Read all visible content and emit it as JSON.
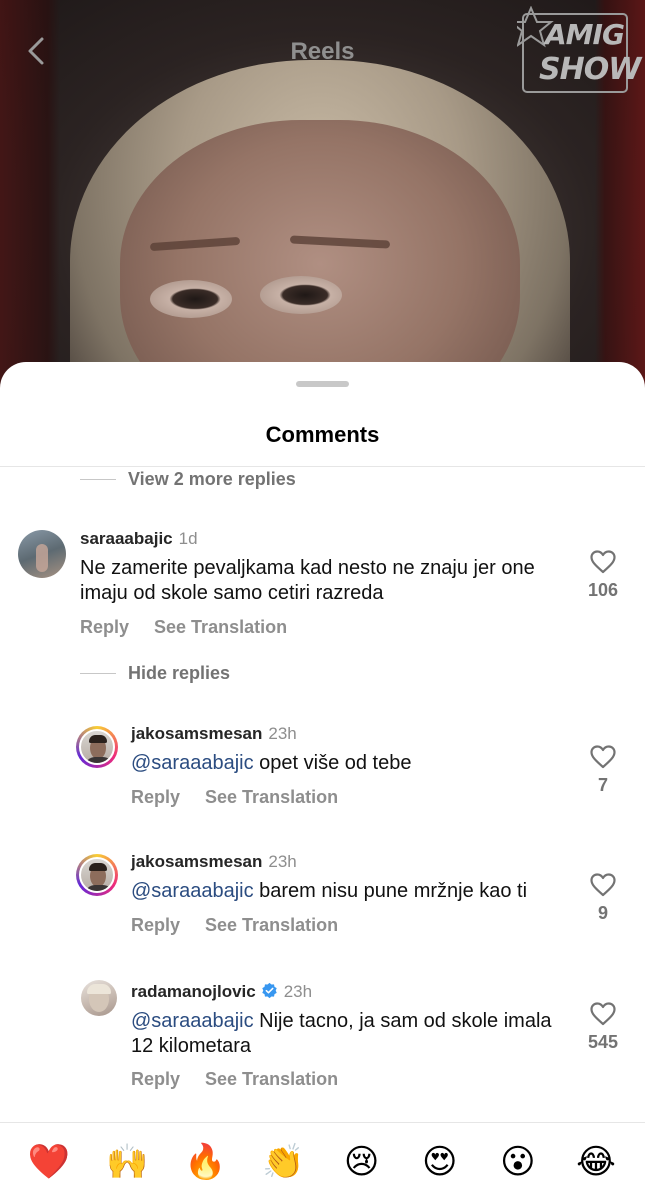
{
  "reel": {
    "title": "Reels",
    "logo_line1": "AMIG",
    "logo_line2": "SHOW"
  },
  "sheet": {
    "title": "Comments",
    "view_more_replies": "View 2 more replies",
    "hide_replies": "Hide replies"
  },
  "comments": [
    {
      "username": "saraaabajic",
      "time": "1d",
      "text": "Ne zamerite pevaljkama kad nesto ne znaju jer one imaju od skole samo cetiri razreda",
      "likes": "106",
      "reply": "Reply",
      "translate": "See Translation"
    },
    {
      "username": "jakosamsmesan",
      "time": "23h",
      "mention": "@saraaabajic",
      "text": " opet više od tebe",
      "likes": "7",
      "reply": "Reply",
      "translate": "See Translation"
    },
    {
      "username": "jakosamsmesan",
      "time": "23h",
      "mention": "@saraaabajic",
      "text": " barem nisu pune mržnje kao ti",
      "likes": "9",
      "reply": "Reply",
      "translate": "See Translation"
    },
    {
      "username": "radamanojlovic",
      "time": "23h",
      "verified": true,
      "mention": "@saraaabajic",
      "text": " Nije tacno, ja sam od skole imala 12 kilometara",
      "likes": "545",
      "reply": "Reply",
      "translate": "See Translation"
    }
  ],
  "emoji_bar": [
    "❤️",
    "🙌",
    "🔥",
    "👏",
    "😢",
    "😍",
    "😮",
    "😂"
  ],
  "colors": {
    "mention": "#2b4c80",
    "secondary_text": "#8e8e8e",
    "verified": "#3897f0"
  }
}
